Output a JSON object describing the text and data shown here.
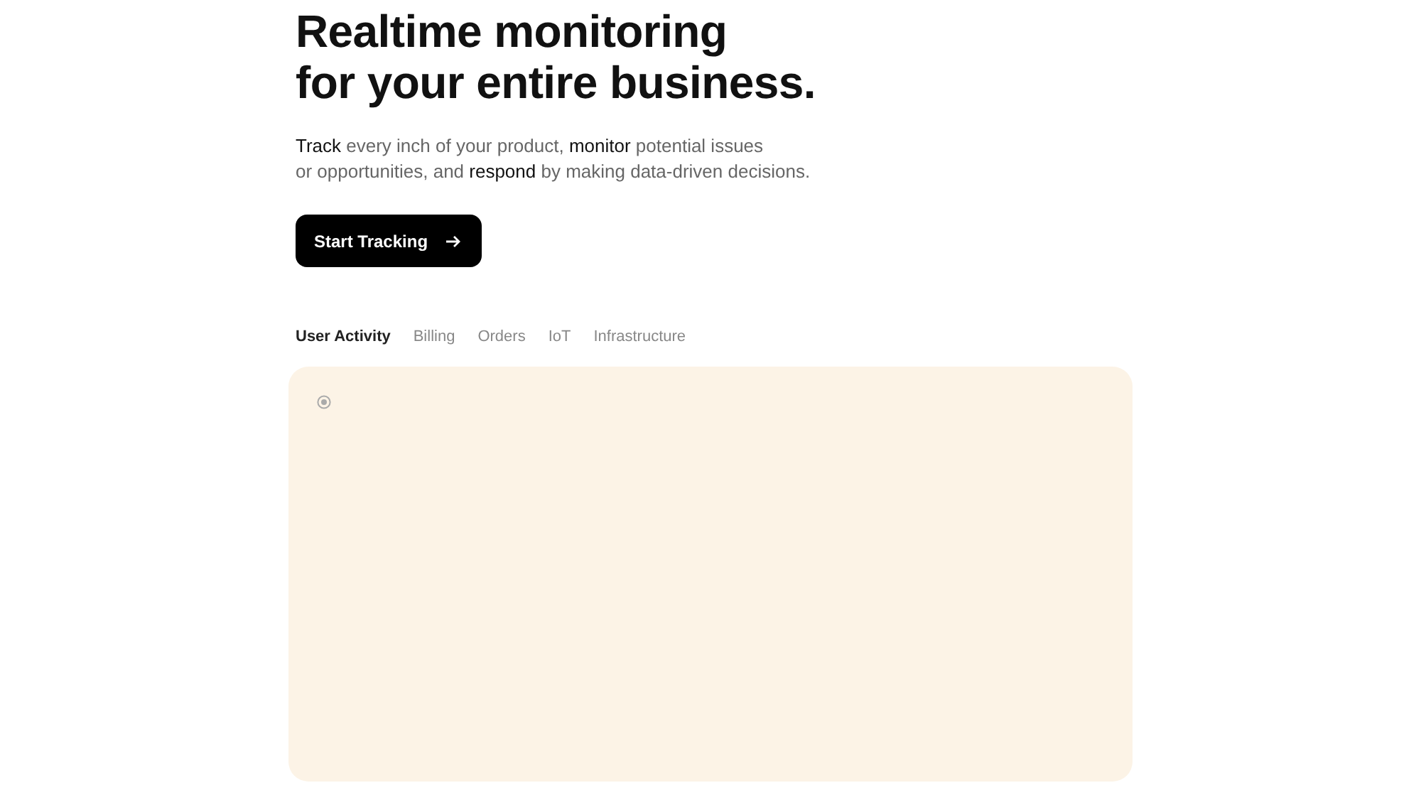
{
  "hero": {
    "title_lines": [
      "Realtime monitoring",
      "for your entire business."
    ],
    "description_lines": [
      "**Track** every inch of your product, **monitor** potential issues",
      "or opportunities, and **respond** by making data-driven decisions."
    ],
    "cta": {
      "label": "Start Tracking"
    }
  },
  "tabs": [
    {
      "label": "User Activity",
      "selected": true
    },
    {
      "label": "Billing",
      "selected": false
    },
    {
      "label": "Orders",
      "selected": false
    },
    {
      "label": "IoT",
      "selected": false
    },
    {
      "label": "Infrastructure",
      "selected": false
    }
  ]
}
